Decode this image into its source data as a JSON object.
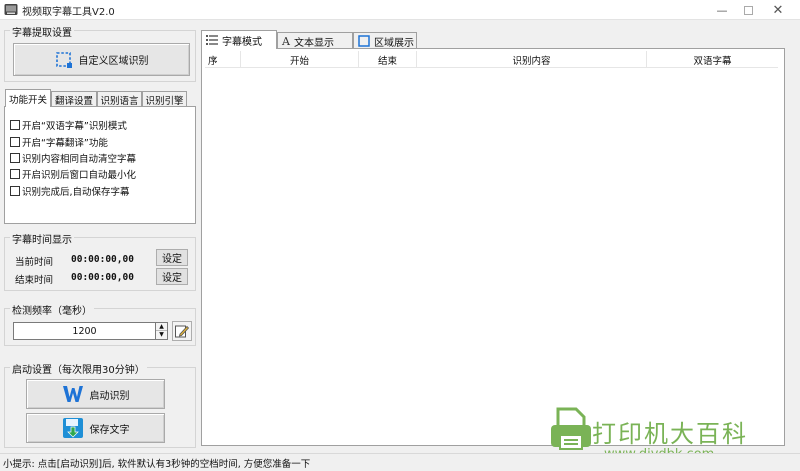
{
  "window": {
    "title": "视频取字幕工具V2.0"
  },
  "extract": {
    "group_title": "字幕提取设置",
    "custom_region_btn": "自定义区域识别"
  },
  "left_tabs": [
    "功能开关",
    "翻译设置",
    "识别语言",
    "识别引擎"
  ],
  "options": [
    "开启“双语字幕”识别模式",
    "开启“字幕翻译”功能",
    "识别内容相同自动清空字幕",
    "开启识别后窗口自动最小化",
    "识别完成后,自动保存字幕"
  ],
  "time": {
    "group_title": "字幕时间显示",
    "current_label": "当前时间",
    "current_value": "00:00:00,00",
    "end_label": "结束时间",
    "end_value": "00:00:00,00",
    "set_label": "设定"
  },
  "frequency": {
    "group_title": "检测频率（毫秒）",
    "value": "1200"
  },
  "start": {
    "group_title": "启动设置（每次限用30分钟）",
    "start_btn": "启动识别",
    "save_btn": "保存文字"
  },
  "right_tabs": [
    "字幕模式",
    "文本显示",
    "区域展示"
  ],
  "table": {
    "columns": [
      "序",
      "开始",
      "结束",
      "识别内容",
      "双语字幕"
    ]
  },
  "status": "小提示: 点击[启动识别]后, 软件默认有3秒钟的空档时间, 方便您准备一下",
  "watermark": {
    "text": "打印机大百科",
    "url": "www.djydbk.com"
  },
  "colors": {
    "accent_blue": "#1e73d6",
    "watermark_green": "#7ab356"
  }
}
